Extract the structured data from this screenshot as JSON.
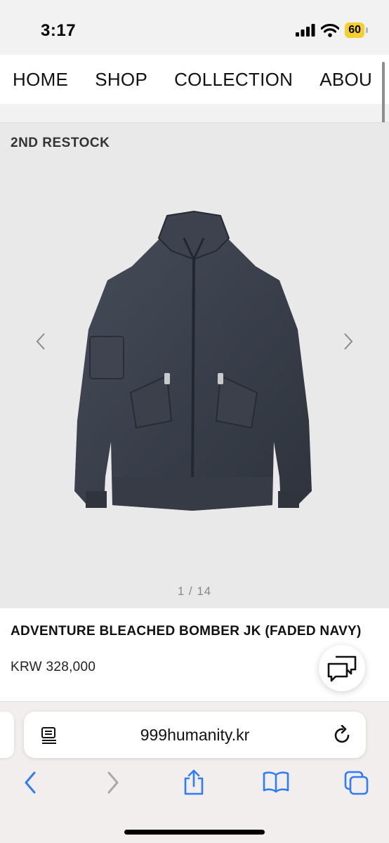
{
  "status_bar": {
    "time": "3:17",
    "battery": "60"
  },
  "nav": {
    "items": [
      "HOME",
      "SHOP",
      "COLLECTION",
      "ABOU"
    ]
  },
  "hero": {
    "badge": "2ND RESTOCK",
    "counter": "1 / 14"
  },
  "product": {
    "title": "ADVENTURE BLEACHED BOMBER JK (FADED NAVY)",
    "price": "KRW 328,000"
  },
  "browser": {
    "url": "999humanity.kr"
  },
  "icons": {
    "prev": "chevron-left-icon",
    "next": "chevron-right-icon",
    "chat": "chat-bubbles-icon",
    "reader": "reader-mode-icon",
    "reload": "reload-icon",
    "back": "back-icon",
    "forward": "forward-icon",
    "share": "share-icon",
    "bookmarks": "bookmarks-icon",
    "tabs": "tabs-icon"
  },
  "colors": {
    "accent": "#2f7cf6",
    "battery": "#f5cf2e",
    "hero_bg": "#e9e9e9",
    "jacket": "#3a3f4b"
  }
}
